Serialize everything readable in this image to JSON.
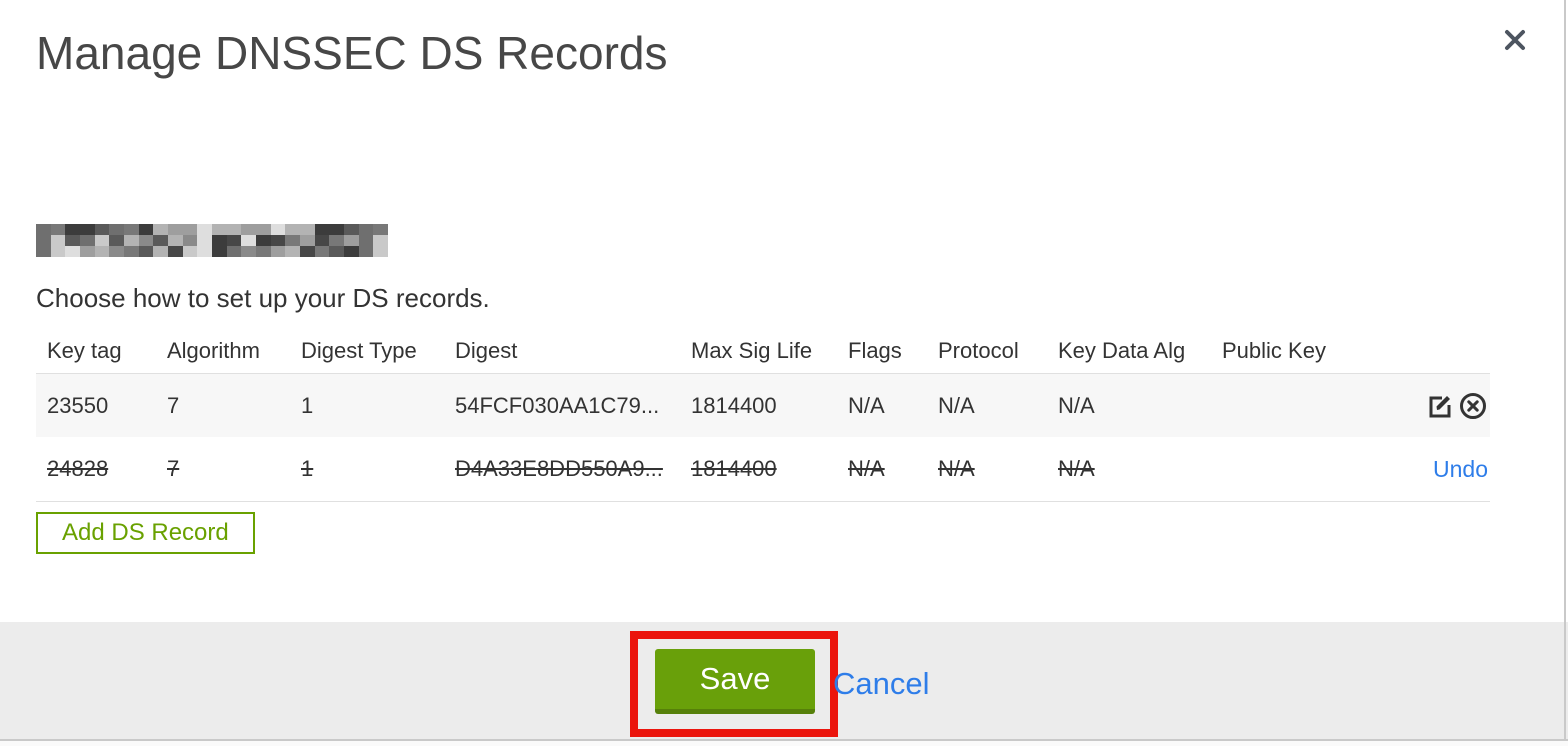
{
  "modal": {
    "title": "Manage DNSSEC DS Records",
    "domain": {
      "redacted": true
    },
    "subtitle": "Choose how to set up your DS records.",
    "table": {
      "columns": [
        "Key tag",
        "Algorithm",
        "Digest Type",
        "Digest",
        "Max Sig Life",
        "Flags",
        "Protocol",
        "Key Data Alg",
        "Public Key"
      ],
      "rows": [
        {
          "key_tag": "23550",
          "algorithm": "7",
          "digest_type": "1",
          "digest": "54FCF030AA1C79...",
          "max_sig_life": "1814400",
          "flags": "N/A",
          "protocol": "N/A",
          "key_data_alg": "N/A",
          "public_key": "",
          "state": "normal",
          "actions": [
            "edit",
            "delete"
          ]
        },
        {
          "key_tag": "24828",
          "algorithm": "7",
          "digest_type": "1",
          "digest": "D4A33E8DD550A9...",
          "max_sig_life": "1814400",
          "flags": "N/A",
          "protocol": "N/A",
          "key_data_alg": "N/A",
          "public_key": "",
          "state": "deleted",
          "undo_label": "Undo"
        }
      ]
    },
    "add_button_label": "Add DS Record",
    "footer": {
      "save_label": "Save",
      "cancel_label": "Cancel"
    }
  },
  "icons": {
    "close": "x-mark",
    "edit": "pencil-in-square",
    "delete": "circle-x"
  },
  "colors": {
    "accent_green": "#69a00a",
    "green_border_dark": "#56800a",
    "outline_green": "#69a100",
    "link_blue": "#2e7de9",
    "annotation_red": "#eb150d",
    "footer_bg": "#ececec",
    "row_alt_bg": "#f7f7f7",
    "title_gray": "#474747"
  }
}
